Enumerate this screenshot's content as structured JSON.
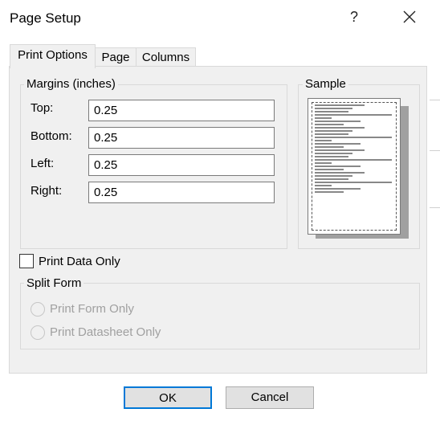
{
  "window": {
    "title": "Page Setup",
    "help_glyph": "?"
  },
  "tabs": [
    {
      "label": "Print Options",
      "active": true
    },
    {
      "label": "Page",
      "active": false
    },
    {
      "label": "Columns",
      "active": false
    }
  ],
  "margins": {
    "legend": "Margins (inches)",
    "top_label": "Top:",
    "top_value": "0.25",
    "bottom_label": "Bottom:",
    "bottom_value": "0.25",
    "left_label": "Left:",
    "left_value": "0.25",
    "right_label": "Right:",
    "right_value": "0.25"
  },
  "sample": {
    "legend": "Sample"
  },
  "print_data_only": {
    "label": "Print Data Only",
    "checked": false
  },
  "split_form": {
    "legend": "Split Form",
    "options": [
      "Print Form Only",
      "Print Datasheet Only"
    ],
    "enabled": false
  },
  "buttons": {
    "ok": "OK",
    "cancel": "Cancel"
  },
  "icons": {
    "close": "close-icon",
    "help": "help-icon"
  },
  "colors": {
    "accent": "#0078d7",
    "panel": "#f0f0f0",
    "disabled_text": "#a0a0a0"
  }
}
